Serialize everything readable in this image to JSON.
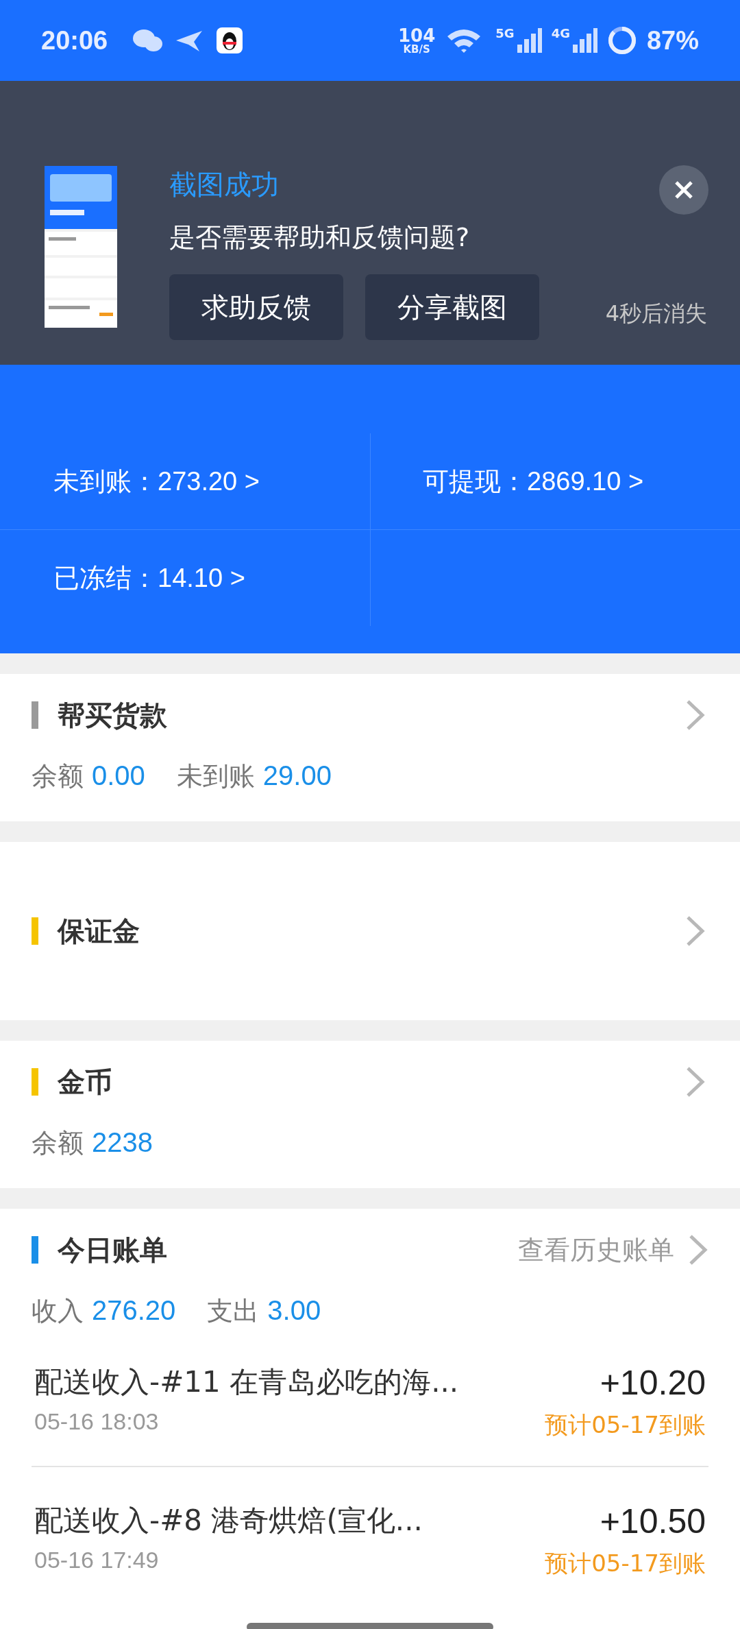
{
  "status_bar": {
    "time": "20:06",
    "net_speed": "104",
    "net_unit": "KB/S",
    "sim1": "5G",
    "sim2": "4G",
    "battery": "87%"
  },
  "stats": [
    {
      "text": "未到账：273.20 >"
    },
    {
      "text": "可提现：2869.10 >"
    },
    {
      "text": "已冻结：14.10 >"
    }
  ],
  "sections": [
    {
      "title": "帮买货款",
      "color": "#9a9a9a",
      "values": [
        {
          "label": "余额",
          "value": "0.00"
        },
        {
          "label": "未到账",
          "value": "29.00"
        }
      ]
    },
    {
      "title": "保证金",
      "color": "#f5c400"
    },
    {
      "title": "金币",
      "color": "#f5c400",
      "values": [
        {
          "label": "余额",
          "value": "2238"
        }
      ]
    }
  ],
  "bills": {
    "title": "今日账单",
    "color": "#1a8fe8",
    "history": "查看历史账单",
    "totals": [
      {
        "label": "收入",
        "value": "276.20"
      },
      {
        "label": "支出",
        "value": "3.00"
      }
    ],
    "rows": [
      {
        "title": "配送收入-#11 在青岛必吃的海...",
        "time": "05-16 18:03",
        "amount": "+10.20",
        "note": "预计05-17到账"
      },
      {
        "title": "配送收入-#8 港奇烘焙(宣化...",
        "time": "05-16 17:49",
        "amount": "+10.50",
        "note": "预计05-17到账"
      }
    ]
  },
  "toast": {
    "title": "截图成功",
    "message": "是否需要帮助和反馈问题?",
    "buttons": [
      "求助反馈",
      "分享截图"
    ],
    "countdown": "4秒后消失"
  }
}
